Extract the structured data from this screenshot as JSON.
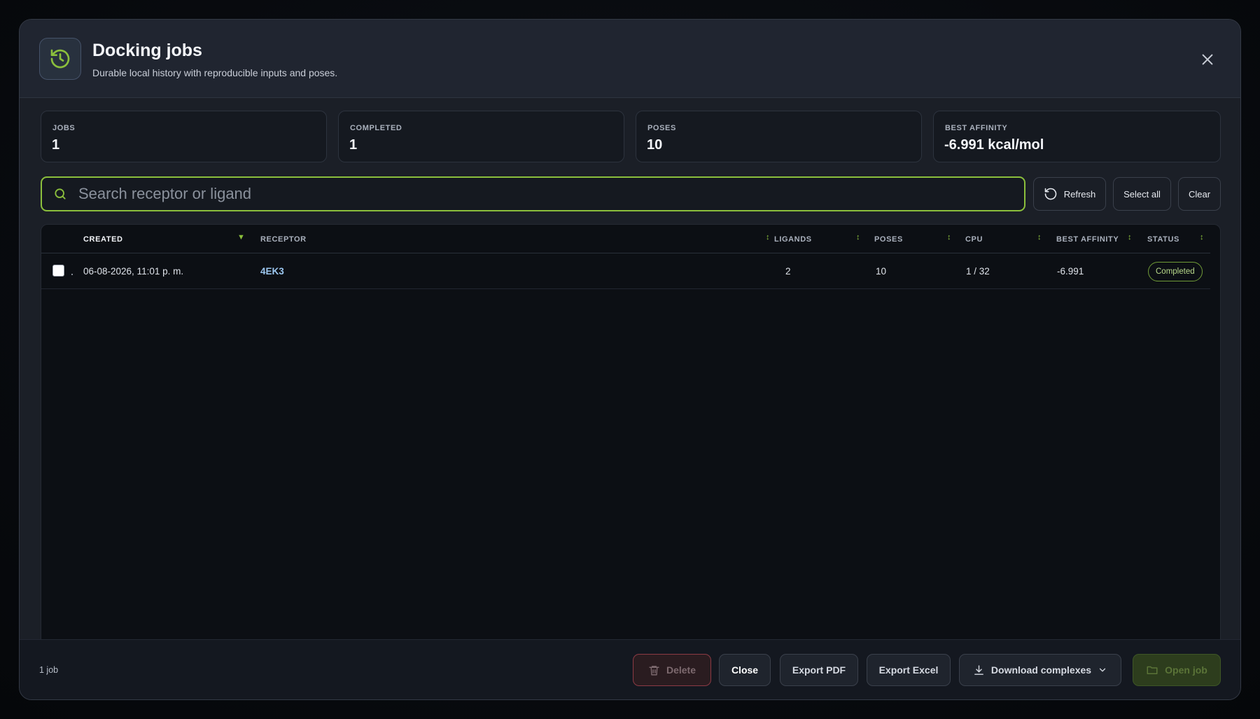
{
  "dialog": {
    "title": "Docking jobs",
    "subtitle": "Durable local history with reproducible inputs and poses."
  },
  "stats": [
    {
      "label": "JOBS",
      "value": "1"
    },
    {
      "label": "COMPLETED",
      "value": "1"
    },
    {
      "label": "POSES",
      "value": "10"
    },
    {
      "label": "BEST AFFINITY",
      "value": "-6.991 kcal/mol"
    }
  ],
  "search": {
    "placeholder": "Search receptor or ligand",
    "value": ""
  },
  "toolbar": {
    "refresh_label": "Refresh",
    "select_all_label": "Select all",
    "clear_label": "Clear"
  },
  "table": {
    "columns": [
      "CREATED",
      "RECEPTOR",
      "LIGANDS",
      "POSES",
      "CPU",
      "BEST AFFINITY",
      "STATUS"
    ],
    "sorted_column": "CREATED",
    "sort_direction": "descending",
    "rows": [
      {
        "selected": false,
        "created": "06-08-2026, 11:01 p. m.",
        "receptor": "4EK3",
        "ligands": "2",
        "poses": "10",
        "cpu": "1 / 32",
        "best_affinity": "-6.991",
        "status": "Completed"
      }
    ]
  },
  "footer": {
    "job_count": "1 job",
    "delete_label": "Delete",
    "close_label": "Close",
    "export_pdf_label": "Export PDF",
    "export_excel_label": "Export Excel",
    "download_label": "Download complexes",
    "open_job_label": "Open job"
  },
  "colors": {
    "accent": "#8bbf3c",
    "link": "#9cc7f0",
    "danger": "#8c3a44",
    "background": "#1b1f27"
  },
  "icons": {
    "header": "history-icon",
    "close": "close-icon",
    "search": "search-icon",
    "refresh": "refresh-icon",
    "delete": "trash-icon",
    "download": "download-icon",
    "dropdown": "chevron-down-icon",
    "open_job": "folder-icon",
    "sort_active": "sort-desc-icon",
    "sort_idle": "sort-icon"
  }
}
